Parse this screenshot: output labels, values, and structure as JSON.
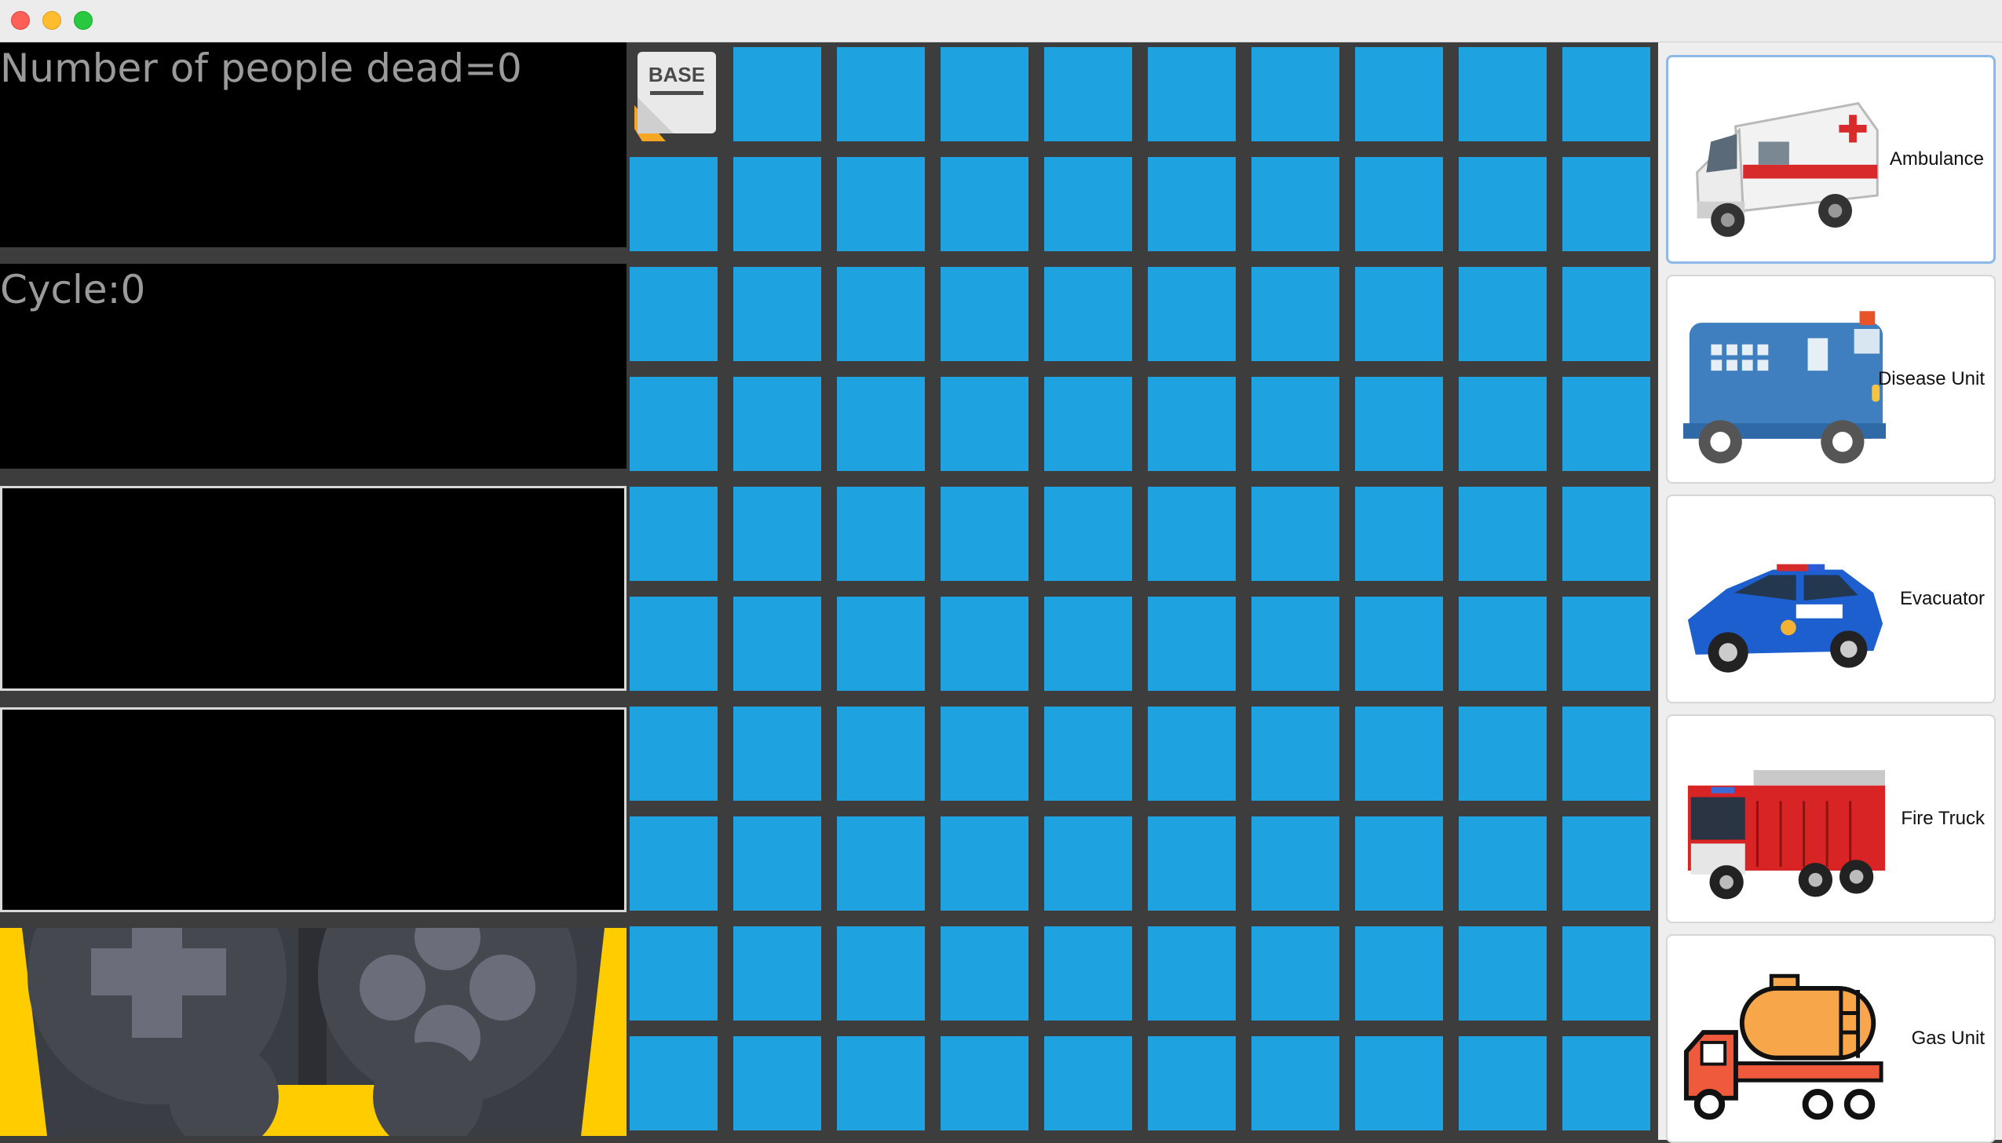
{
  "window": {
    "controls": [
      "close",
      "minimize",
      "zoom"
    ]
  },
  "stats": {
    "dead_label": "Number of people dead=0",
    "cycle_label": "Cycle:0"
  },
  "grid": {
    "rows": 10,
    "cols": 10,
    "base_label": "BASE",
    "base_cell": [
      0,
      0
    ],
    "cell_color": "#1fa3e0"
  },
  "units": [
    {
      "name": "Ambulance",
      "icon": "ambulance-icon",
      "selected": true
    },
    {
      "name": "Disease Unit",
      "icon": "disease-unit-truck-icon"
    },
    {
      "name": "Evacuator",
      "icon": "police-car-icon"
    },
    {
      "name": "Fire Truck",
      "icon": "fire-truck-icon"
    },
    {
      "name": "Gas Unit",
      "icon": "gas-tanker-truck-icon"
    }
  ],
  "colors": {
    "accent_yellow": "#ffcc00",
    "panel_black": "#000000",
    "grid_gap": "#3d3d3d"
  }
}
